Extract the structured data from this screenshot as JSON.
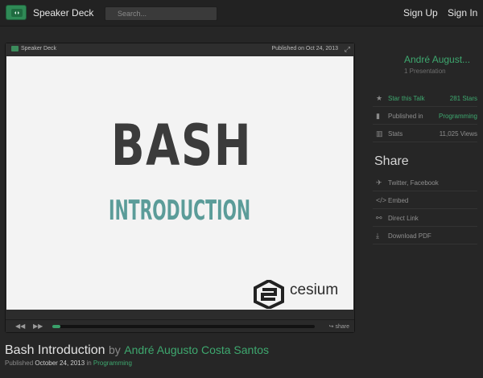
{
  "header": {
    "brand": "Speaker Deck",
    "search_placeholder": "Search...",
    "sign_up": "Sign Up",
    "sign_in": "Sign In",
    "logo_icon": "speakerdeck-logo-icon"
  },
  "player": {
    "brand": "Speaker Deck",
    "published": "Published on Oct 24, 2013",
    "expand_icon": "expand-icon",
    "slide_title": "BASH",
    "slide_subtitle": "INTRODUCTION",
    "slide_logo_text": "cesium",
    "progress_fraction": 0.03,
    "share_label": "share",
    "colors": {
      "accent": "#3aa06a",
      "slide_subtitle": "#5b9c99",
      "slide_bg": "#f3f3f3"
    }
  },
  "sidebar": {
    "author": "André August...",
    "presentations": "1 Presentation",
    "star_label": "Star this Talk",
    "stars": "281 Stars",
    "published_label": "Published in",
    "category": "Programming",
    "stats_label": "Stats",
    "views": "11,025 Views",
    "share_title": "Share",
    "share_items": [
      "Twitter, Facebook",
      "Embed",
      "Direct Link",
      "Download PDF"
    ]
  },
  "talk": {
    "title": "Bash Introduction",
    "by": "by",
    "author": "André Augusto Costa Santos",
    "published_prefix": "Published",
    "date": "October 24, 2013",
    "in": "in",
    "category": "Programming"
  }
}
